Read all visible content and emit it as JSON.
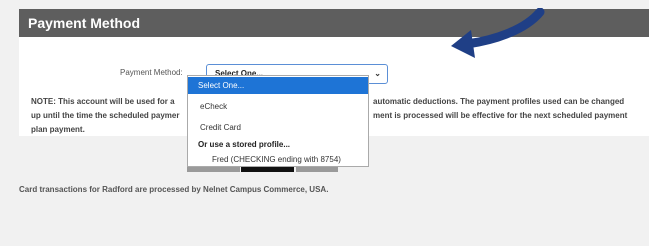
{
  "header": {
    "title": "Payment Method"
  },
  "form": {
    "payment_method_label": "Payment Method:",
    "select_value": "Select One..."
  },
  "dropdown": {
    "options": [
      "Select One...",
      "eCheck",
      "Credit Card"
    ],
    "group_label": "Or use a stored profile...",
    "stored_profile": "Fred (CHECKING ending with 8754)"
  },
  "note": {
    "line1_left": "NOTE:  This account will be used for a",
    "line1_right": "automatic deductions. The payment profiles used can be changed",
    "line2_left": "up until the time the scheduled paymer",
    "line2_right": "ment is processed will be effective for the next scheduled payment",
    "line3": "plan payment."
  },
  "footer": {
    "text": "Card transactions for Radford are processed by Nelnet Campus Commerce, USA."
  },
  "colors": {
    "header_bg": "#5e5e5e",
    "selected_option_bg": "#1e74d6",
    "arrow": "#1f3f86"
  },
  "icons": {
    "select_chevron": "chevron-down-icon",
    "annotation_arrow": "arrow-icon"
  }
}
